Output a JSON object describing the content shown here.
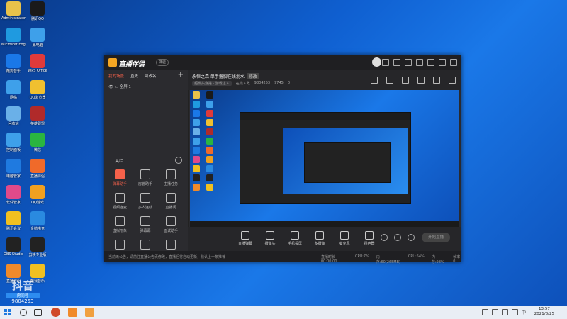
{
  "desktop_icons": [
    {
      "label": "Administrator",
      "color": "#e8c24a"
    },
    {
      "label": "腾讯QQ",
      "color": "#1a1a1a"
    },
    {
      "label": "Microsoft Edge",
      "color": "#1f9ae0"
    },
    {
      "label": "此电脑",
      "color": "#3ea0ea"
    },
    {
      "label": "酷狗音乐",
      "color": "#1a78e8"
    },
    {
      "label": "WPS Office",
      "color": "#e03a3a"
    },
    {
      "label": "网络",
      "color": "#3ea0ea"
    },
    {
      "label": "QQ浏览器",
      "color": "#f0c030"
    },
    {
      "label": "回收站",
      "color": "#6ab0e8"
    },
    {
      "label": "英雄联盟",
      "color": "#b02a2a"
    },
    {
      "label": "控制面板",
      "color": "#3ea0ea"
    },
    {
      "label": "微信",
      "color": "#2ab540"
    },
    {
      "label": "电脑管家",
      "color": "#1f7ae0"
    },
    {
      "label": "直播伴侣",
      "color": "#f06a2a"
    },
    {
      "label": "软件管家",
      "color": "#e04a8a"
    },
    {
      "label": "QQ游戏",
      "color": "#f0a020"
    },
    {
      "label": "腾讯会议",
      "color": "#f0c020"
    },
    {
      "label": "企鹅电竞",
      "color": "#2a8ae0"
    },
    {
      "label": "OBS Studio",
      "color": "#222222"
    },
    {
      "label": "剪映专业版",
      "color": "#222222"
    },
    {
      "label": "直播伴侣",
      "color": "#f08a2a"
    },
    {
      "label": "酷我音乐",
      "color": "#f0c020"
    }
  ],
  "app": {
    "logo": "直播伴侣",
    "version_badge": "体验",
    "sidebar_tabs": [
      "我的场景",
      "直先",
      "可改名"
    ],
    "scene_name": "全屏 1",
    "tools_label": "工具栏",
    "tools": [
      {
        "label": "弹幕助手",
        "hot": true
      },
      {
        "label": "房管助手",
        "hot": false
      },
      {
        "label": "主播任务",
        "hot": false
      },
      {
        "label": "视频连麦",
        "hot": false
      },
      {
        "label": "多人连线",
        "hot": false
      },
      {
        "label": "直播间",
        "hot": false
      },
      {
        "label": "虚拟形象",
        "hot": false
      },
      {
        "label": "弹幕幕",
        "hot": false
      },
      {
        "label": "面试助手",
        "hot": false
      },
      {
        "label": "",
        "hot": false
      },
      {
        "label": "",
        "hot": false
      },
      {
        "label": "",
        "hot": false
      }
    ],
    "room_title": "永恒之森 单手撸脚在线划水",
    "room_badge": "修改",
    "room_category": "超燃头穿搭 · 游戏达人",
    "room_stats": [
      "在线人数",
      "9804253",
      "9745",
      "0"
    ],
    "bottom_items": [
      "直播弹幕",
      "摄像头",
      "手机投屏",
      "多摄像",
      "麦克风",
      "扬声器"
    ],
    "go_live": "开始直播",
    "status_message": "当前无公告，请前往直播公告页修改，直播后将自动更新，默认上一条推荐",
    "status_stats": [
      "直播时长00:00:00",
      "CPU:7%",
      "内存:60(265MB)",
      "CPU:54%",
      "内存:98%",
      "帧率0"
    ]
  },
  "watermark": {
    "label": "房间号",
    "number": "9804253"
  },
  "taskbar": {
    "time": "13:57",
    "date": "2021/8/25",
    "lang": "中"
  }
}
